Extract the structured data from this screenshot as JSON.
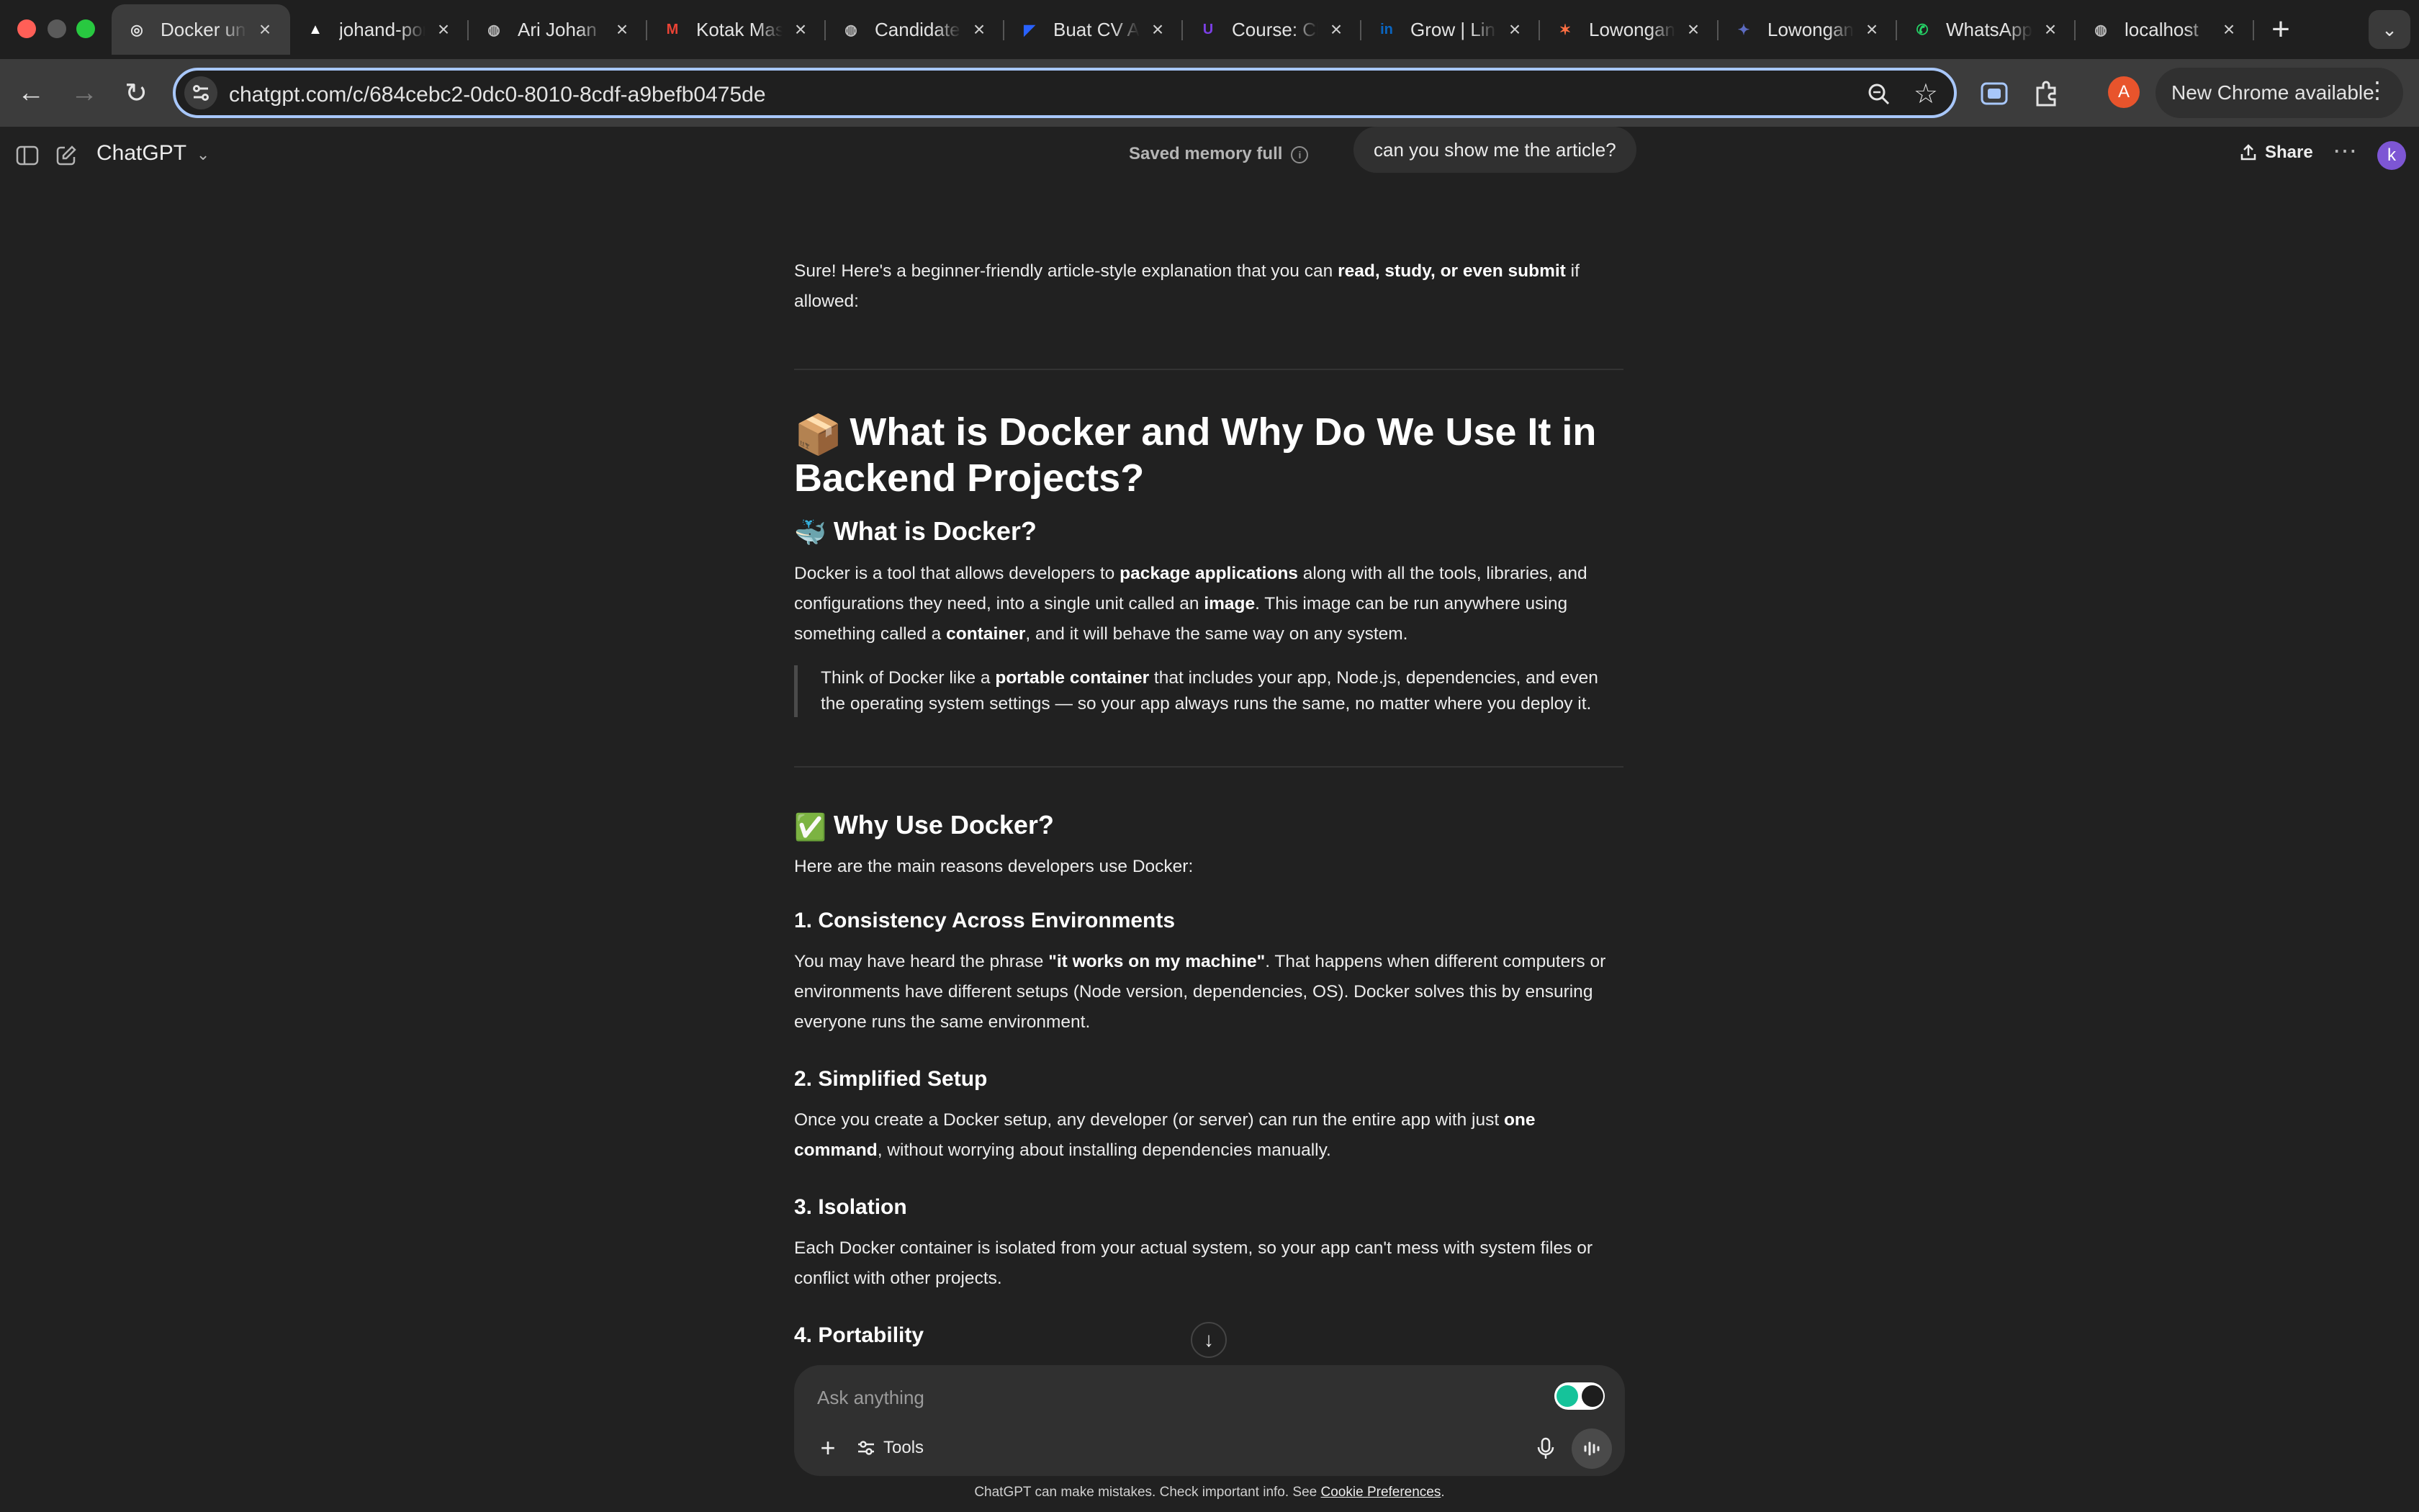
{
  "browser": {
    "tabs": [
      {
        "title": "Docker untuk Backend",
        "favicon": "chatgpt-icon",
        "color": "#e3e3e3",
        "glyph": "◎",
        "active": true
      },
      {
        "title": "johand-portfolio",
        "favicon": "vercel-icon",
        "color": "#ffffff",
        "glyph": "▲"
      },
      {
        "title": "Ari Johan",
        "favicon": "globe-icon",
        "color": "#bdbdbd",
        "glyph": "◍"
      },
      {
        "title": "Kotak Masuk",
        "favicon": "gmail-icon",
        "color": "#ea4335",
        "glyph": "M"
      },
      {
        "title": "Candidate",
        "favicon": "globe-icon",
        "color": "#bdbdbd",
        "glyph": "◍"
      },
      {
        "title": "Buat CV ATS",
        "favicon": "cv-icon",
        "color": "#2962ff",
        "glyph": "◤"
      },
      {
        "title": "Course: Clean",
        "favicon": "course-icon",
        "color": "#7b3fe4",
        "glyph": "U"
      },
      {
        "title": "Grow | LinkedIn",
        "favicon": "linkedin-icon",
        "color": "#0a66c2",
        "glyph": "in"
      },
      {
        "title": "Lowongan",
        "favicon": "star-app-icon",
        "color": "#ff7043",
        "glyph": "✶"
      },
      {
        "title": "Lowongan",
        "favicon": "sparkle-app-icon",
        "color": "#5c6bc0",
        "glyph": "✦"
      },
      {
        "title": "WhatsApp",
        "favicon": "whatsapp-icon",
        "color": "#25d366",
        "glyph": "✆"
      },
      {
        "title": "localhost",
        "favicon": "globe-icon",
        "color": "#bdbdbd",
        "glyph": "◍"
      }
    ],
    "url": "chatgpt.com/c/684cebc2-0dc0-8010-8cdf-a9befb0475de",
    "profile_initial": "A",
    "update_label": "New Chrome available"
  },
  "header": {
    "model": "ChatGPT",
    "memory": "Saved memory full",
    "user_message": "can you show me the article?",
    "share": "Share",
    "avatar_initial": "k"
  },
  "article": {
    "intro_a": "Sure! Here's a beginner-friendly article-style explanation that you can ",
    "intro_b": "read, study, or even submit",
    "intro_c": " if allowed:",
    "title_emoji": "📦",
    "title": "What is Docker and Why Do We Use It in Backend Projects?",
    "s1_emoji": "🐳",
    "s1_title": "What is Docker?",
    "s1_p_a": "Docker is a tool that allows developers to ",
    "s1_p_b": "package applications",
    "s1_p_c": " along with all the tools, libraries, and configurations they need, into a single unit called an ",
    "s1_p_d": "image",
    "s1_p_e": ". This image can be run anywhere using something called a ",
    "s1_p_f": "container",
    "s1_p_g": ", and it will behave the same way on any system.",
    "quote_a": "Think of Docker like a ",
    "quote_b": "portable container",
    "quote_c": " that includes your app, Node.js, dependencies, and even the operating system settings — so your app always runs the same, no matter where you deploy it.",
    "s2_emoji": "✅",
    "s2_title": "Why Use Docker?",
    "s2_intro": "Here are the main reasons developers use Docker:",
    "r1_title": "1. Consistency Across Environments",
    "r1_a": "You may have heard the phrase ",
    "r1_b": "\"it works on my machine\"",
    "r1_c": ". That happens when different computers or environments have different setups (Node version, dependencies, OS). Docker solves this by ensuring everyone runs the same environment.",
    "r2_title": "2. Simplified Setup",
    "r2_a": "Once you create a Docker setup, any developer (or server) can run the entire app with just ",
    "r2_b": "one command",
    "r2_c": ", without worrying about installing dependencies manually.",
    "r3_title": "3. Isolation",
    "r3_p": "Each Docker container is isolated from your actual system, so your app can't mess with system files or conflict with other projects.",
    "r4_title": "4. Portability"
  },
  "composer": {
    "placeholder": "Ask anything",
    "tools": "Tools"
  },
  "footer": {
    "text": "ChatGPT can make mistakes. Check important info. See ",
    "link": "Cookie Preferences",
    "end": "."
  },
  "colors": {
    "background": "#212121",
    "composer": "#303030",
    "omnibox_focus": "#a8c7fa",
    "profile": "#e8542c",
    "avatar": "#7d56d4"
  }
}
